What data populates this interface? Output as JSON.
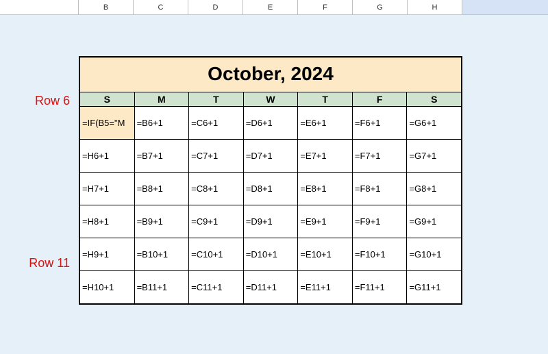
{
  "columns": [
    "",
    "B",
    "C",
    "D",
    "E",
    "F",
    "G",
    "H",
    ""
  ],
  "title": "October, 2024",
  "dow": [
    "S",
    "M",
    "T",
    "W",
    "T",
    "F",
    "S"
  ],
  "row_labels": {
    "r6": "Row 6",
    "r11": "Row 11"
  },
  "cells": {
    "r6": [
      "=IF(B5=\"M",
      "=B6+1",
      "=C6+1",
      "=D6+1",
      "=E6+1",
      "=F6+1",
      "=G6+1"
    ],
    "r7": [
      "=H6+1",
      "=B7+1",
      "=C7+1",
      "=D7+1",
      "=E7+1",
      "=F7+1",
      "=G7+1"
    ],
    "r8": [
      "=H7+1",
      "=B8+1",
      "=C8+1",
      "=D8+1",
      "=E8+1",
      "=F8+1",
      "=G8+1"
    ],
    "r9": [
      "=H8+1",
      "=B9+1",
      "=C9+1",
      "=D9+1",
      "=E9+1",
      "=F9+1",
      "=G9+1"
    ],
    "r10": [
      "=H9+1",
      "=B10+1",
      "=C10+1",
      "=D10+1",
      "=E10+1",
      "=F10+1",
      "=G10+1"
    ],
    "r11": [
      "=H10+1",
      "=B11+1",
      "=C11+1",
      "=D11+1",
      "=E11+1",
      "=F11+1",
      "=G11+1"
    ]
  }
}
